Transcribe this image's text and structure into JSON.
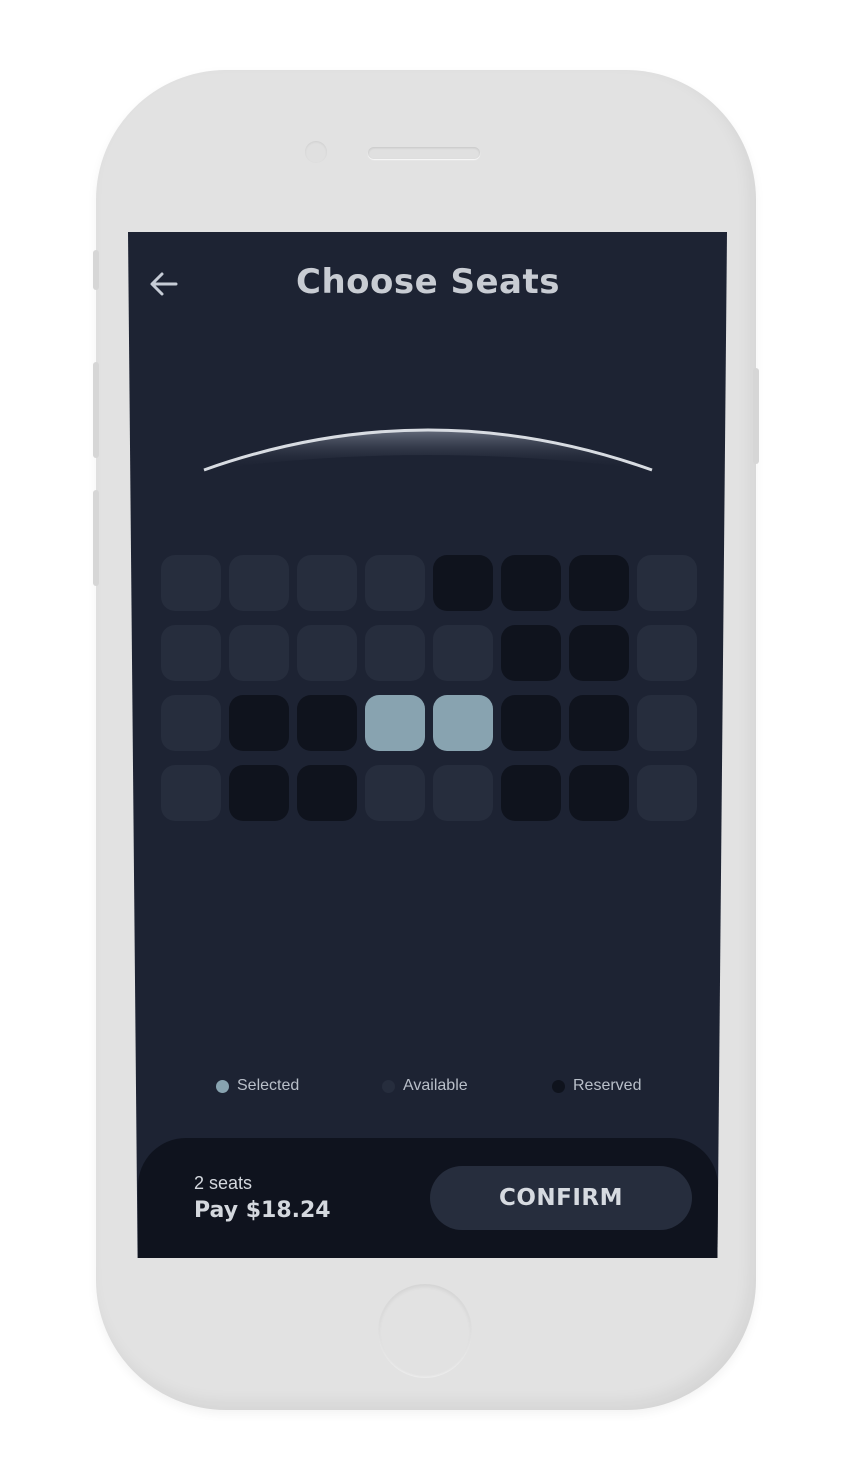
{
  "header": {
    "title": "Choose Seats",
    "back_icon": "arrow-left-icon"
  },
  "seat_map": {
    "columns": 8,
    "rows": [
      [
        "available",
        "available",
        "available",
        "available",
        "reserved",
        "reserved",
        "reserved",
        "available"
      ],
      [
        "available",
        "available",
        "available",
        "available",
        "available",
        "reserved",
        "reserved",
        "available"
      ],
      [
        "available",
        "reserved",
        "reserved",
        "selected",
        "selected",
        "reserved",
        "reserved",
        "available"
      ],
      [
        "available",
        "reserved",
        "reserved",
        "available",
        "available",
        "reserved",
        "reserved",
        "available"
      ]
    ]
  },
  "legend": [
    {
      "label": "Selected",
      "status": "selected",
      "color": "#88a3b0"
    },
    {
      "label": "Available",
      "status": "available",
      "color": "#262d3d"
    },
    {
      "label": "Reserved",
      "status": "reserved",
      "color": "#0f131d"
    }
  ],
  "footer": {
    "seat_count": "2 seats",
    "pay_label": "Pay $18.24",
    "confirm_label": "CONFIRM"
  },
  "colors": {
    "background": "#1d2333",
    "available": "#262d3d",
    "reserved": "#0f131d",
    "selected": "#88a3b0",
    "footer": "#0f131e"
  }
}
